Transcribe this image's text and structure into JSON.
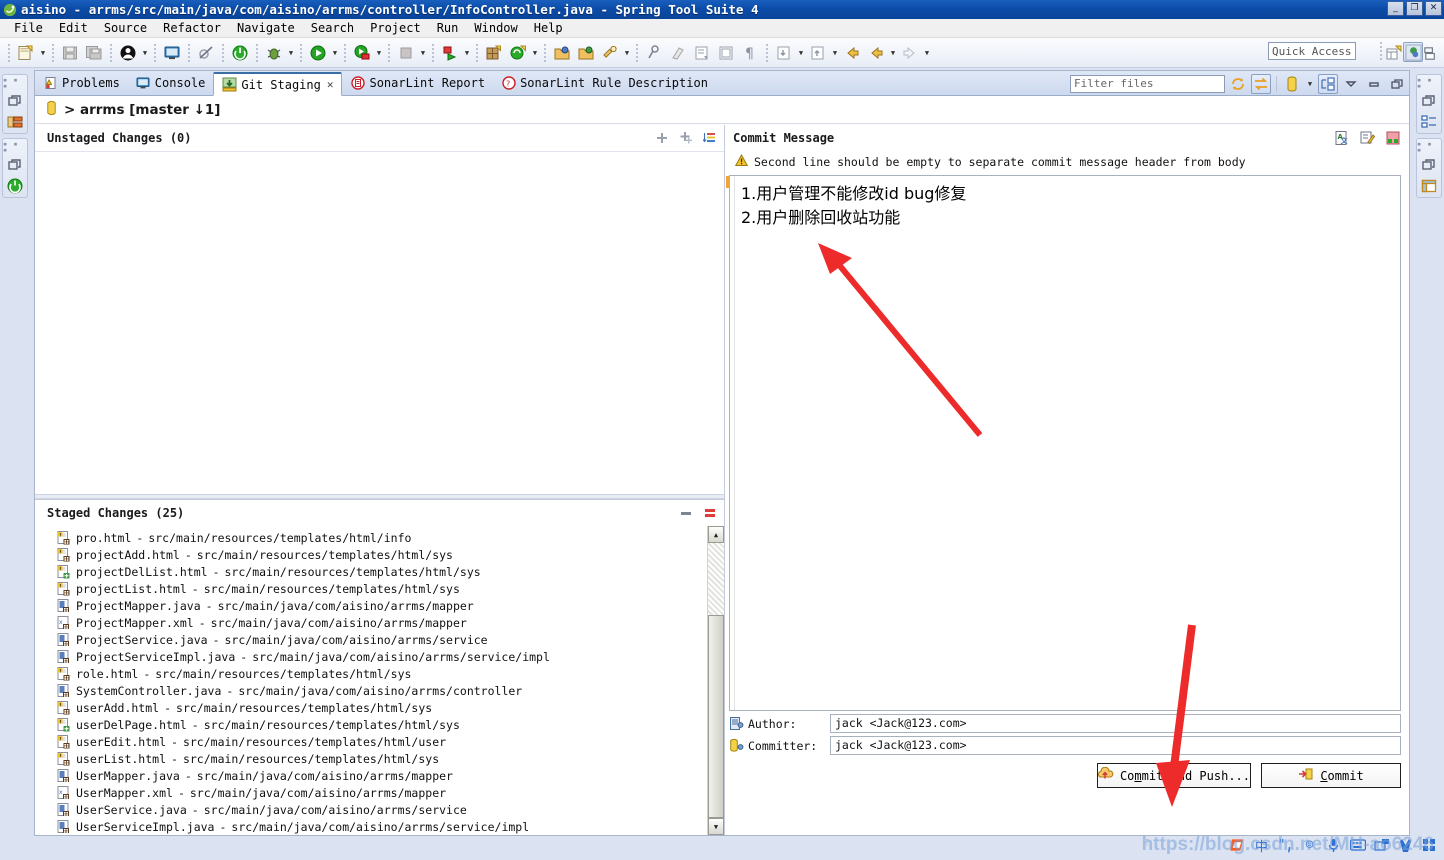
{
  "window": {
    "title": "aisino - arrms/src/main/java/com/aisino/arrms/controller/InfoController.java - Spring Tool Suite 4",
    "minimize": "_",
    "maximize": "❐",
    "close": "✕"
  },
  "menu": {
    "items": [
      "File",
      "Edit",
      "Source",
      "Refactor",
      "Navigate",
      "Search",
      "Project",
      "Run",
      "Window",
      "Help"
    ]
  },
  "toolbar": {
    "quick_access_placeholder": "Quick Access",
    "icons": [
      "new-file-icon",
      "save-icon",
      "save-all-icon",
      "user-icon",
      "console-icon",
      "skip-breakpoints-icon",
      "terminate-icon",
      "debug-icon",
      "run-icon",
      "run-server-icon",
      "stop-icon",
      "external-tools-icon",
      "new-package-icon",
      "new-element-icon",
      "open-type-icon",
      "open-resource-icon",
      "search-icon",
      "pin-icon",
      "clean-icon",
      "next-annotation-icon",
      "previous-annotation-icon",
      "paragraph-icon",
      "last-edit-icon",
      "forward-edit-icon",
      "back-icon",
      "backward-icon",
      "forward-icon",
      "new-window-icon",
      "perspective-java-icon",
      "perspective-other-icon"
    ]
  },
  "view_tabs": [
    {
      "label": "Problems",
      "icon": "problems-icon",
      "active": false,
      "closeable": false
    },
    {
      "label": "Console",
      "icon": "console-icon",
      "active": false,
      "closeable": false
    },
    {
      "label": "Git Staging",
      "icon": "git-staging-icon",
      "active": true,
      "closeable": true
    },
    {
      "label": "SonarLint Report",
      "icon": "sonarlint-icon",
      "active": false,
      "closeable": false
    },
    {
      "label": "SonarLint Rule Description",
      "icon": "sonarlint-rule-icon",
      "active": false,
      "closeable": false
    }
  ],
  "view_toolbar": {
    "filter_placeholder": "Filter files",
    "refresh_icon": "refresh-icon",
    "switch_icon": "switch-repository-icon",
    "repo_icon": "repository-icon",
    "dropdown_icon": "chevron-down-icon",
    "presentation_icon": "presentation-icon",
    "view_menu_icon": "view-menu-icon",
    "minimize_icon": "minimize-icon",
    "maximize_icon": "maximize-icon"
  },
  "repository": {
    "icon": "repository-icon",
    "label": "> arrms [master ↓1]"
  },
  "unstaged": {
    "title": "Unstaged Changes (0)",
    "tools": [
      "stage-icon",
      "stage-all-icon",
      "sort-icon"
    ],
    "files": []
  },
  "staged": {
    "title": "Staged Changes (25)",
    "tools": [
      "unstage-icon",
      "unstage-all-icon"
    ],
    "files": [
      {
        "name": "pro.html",
        "path": "src/main/resources/templates/html/info",
        "icon": "html-modified-icon"
      },
      {
        "name": "projectAdd.html",
        "path": "src/main/resources/templates/html/sys",
        "icon": "html-modified-icon"
      },
      {
        "name": "projectDelList.html",
        "path": "src/main/resources/templates/html/sys",
        "icon": "html-added-icon"
      },
      {
        "name": "projectList.html",
        "path": "src/main/resources/templates/html/sys",
        "icon": "html-modified-icon"
      },
      {
        "name": "ProjectMapper.java",
        "path": "src/main/java/com/aisino/arrms/mapper",
        "icon": "java-modified-icon"
      },
      {
        "name": "ProjectMapper.xml",
        "path": "src/main/java/com/aisino/arrms/mapper",
        "icon": "xml-modified-icon"
      },
      {
        "name": "ProjectService.java",
        "path": "src/main/java/com/aisino/arrms/service",
        "icon": "java-modified-icon"
      },
      {
        "name": "ProjectServiceImpl.java",
        "path": "src/main/java/com/aisino/arrms/service/impl",
        "icon": "java-modified-icon"
      },
      {
        "name": "role.html",
        "path": "src/main/resources/templates/html/sys",
        "icon": "html-modified-icon"
      },
      {
        "name": "SystemController.java",
        "path": "src/main/java/com/aisino/arrms/controller",
        "icon": "java-modified-icon"
      },
      {
        "name": "userAdd.html",
        "path": "src/main/resources/templates/html/sys",
        "icon": "html-modified-icon"
      },
      {
        "name": "userDelPage.html",
        "path": "src/main/resources/templates/html/sys",
        "icon": "html-added-icon"
      },
      {
        "name": "userEdit.html",
        "path": "src/main/resources/templates/html/user",
        "icon": "html-modified-icon"
      },
      {
        "name": "userList.html",
        "path": "src/main/resources/templates/html/sys",
        "icon": "html-modified-icon"
      },
      {
        "name": "UserMapper.java",
        "path": "src/main/java/com/aisino/arrms/mapper",
        "icon": "java-modified-icon"
      },
      {
        "name": "UserMapper.xml",
        "path": "src/main/java/com/aisino/arrms/mapper",
        "icon": "xml-modified-icon"
      },
      {
        "name": "UserService.java",
        "path": "src/main/java/com/aisino/arrms/service",
        "icon": "java-modified-icon"
      },
      {
        "name": "UserServiceImpl.java",
        "path": "src/main/java/com/aisino/arrms/service/impl",
        "icon": "java-modified-icon"
      }
    ],
    "separator": "-"
  },
  "commit": {
    "title": "Commit Message",
    "tools": [
      "spellcheck-icon",
      "sign-off-icon",
      "amend-icon"
    ],
    "warning_icon": "warning-icon",
    "warning": "Second line should be empty to separate commit message header from body",
    "message_lines": [
      "1.用户管理不能修改id bug修复",
      "2.用户删除回收站功能"
    ],
    "author": {
      "icon": "author-icon",
      "label": "Author:",
      "value": "jack <Jack@123.com>"
    },
    "committer": {
      "icon": "committer-icon",
      "label": "Committer:",
      "value": "jack <Jack@123.com>"
    },
    "buttons": [
      {
        "name": "commit-and-push-button",
        "label_pre": "Co",
        "label_u": "m",
        "label_post": "mit and Push...",
        "icon": "push-icon"
      },
      {
        "name": "commit-button",
        "label_pre": "",
        "label_u": "C",
        "label_post": "ommit",
        "icon": "commit-icon"
      }
    ]
  },
  "trim": {
    "left": [
      {
        "restore": "restore-icon",
        "icon": "package-explorer-icon"
      },
      {
        "restore": "restore-icon",
        "icon": "boot-dashboard-icon"
      }
    ],
    "right": [
      {
        "restore": "restore-icon",
        "icon": "outline-icon"
      },
      {
        "restore": "restore-icon",
        "icon": "task-list-icon"
      }
    ]
  },
  "ime": {
    "items": [
      "sogou-logo",
      "中",
      "\"̦,",
      "☺",
      "🎤",
      "⌨",
      "📇",
      "✂",
      "▦"
    ],
    "watermark": "https://blog.csdn.net/MH-ao6246"
  },
  "colors": {
    "title_bar_start": "#1a5fbe",
    "title_bar_end": "#0a4399",
    "accent_tab": "#3a6ea5",
    "annotation_arrow": "#ee2b2b",
    "warning_yellow": "#e8b339",
    "java_icon": "#5a7fbe",
    "html_icon": "#e8e8e8"
  }
}
